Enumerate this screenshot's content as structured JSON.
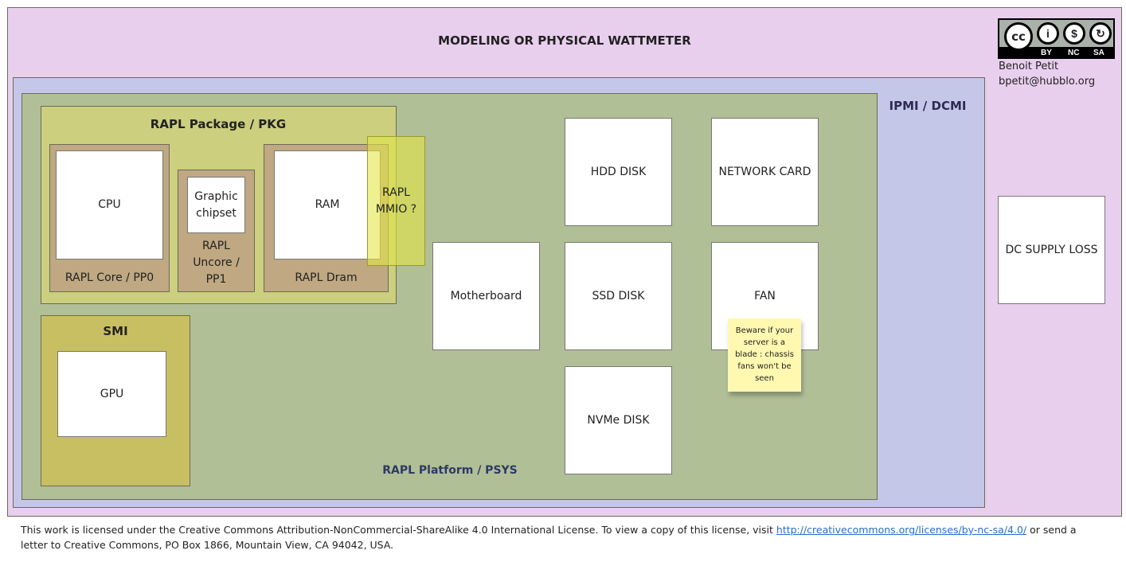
{
  "title": "MODELING OR PHYSICAL WATTMETER",
  "ipmi": "IPMI / DCMI",
  "platform": "RAPL Platform / PSYS",
  "pkg": "RAPL Package / PKG",
  "core": {
    "box": "CPU",
    "label": "RAPL Core / PP0"
  },
  "uncore": {
    "box": "Graphic chipset",
    "label": "RAPL Uncore / PP1"
  },
  "dram": {
    "box": "RAM",
    "label": "RAPL Dram"
  },
  "mmio": "RAPL MMIO ?",
  "smi": {
    "label": "SMI",
    "box": "GPU"
  },
  "components": {
    "motherboard": "Motherboard",
    "hdd": "HDD DISK",
    "network": "NETWORK CARD",
    "ssd": "SSD DISK",
    "fan": "FAN",
    "nvme": "NVMe DISK"
  },
  "note": "Beware if your server is a blade : chassis fans won't be seen",
  "dc": "DC SUPPLY LOSS",
  "license_badge": {
    "items": [
      "BY",
      "NC",
      "SA"
    ]
  },
  "author": {
    "name": "Benoit Petit",
    "email": "bpetit@hubblo.org"
  },
  "footer": {
    "text1": "This work is licensed under the Creative Commons Attribution-NonCommercial-ShareAlike 4.0 International License. To view a copy of this license, visit ",
    "link": "http://creativecommons.org/licenses/by-nc-sa/4.0/",
    "text2": " or send a letter to Creative Commons, PO Box 1866, Mountain View, CA 94042, USA."
  },
  "colors": {
    "wattmeter": "#e9cfee",
    "ipmi": "#c4c7e7",
    "psys": "#b0bf96",
    "pkg": "#cbcf7e",
    "rapl_domain": "#bfa882",
    "smi": "#c8bf62",
    "note": "#fff8b0"
  }
}
